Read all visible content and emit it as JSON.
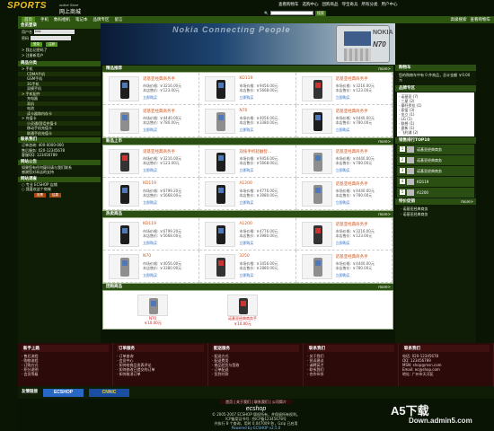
{
  "header": {
    "logo_main": "SPORTS",
    "logo_sub": "online Store",
    "logo_cn": "网上商城",
    "top_links": [
      "查看购物车",
      "选购中心",
      "团购商品",
      "夺宝奇兵",
      "所有分类",
      "用户中心"
    ],
    "search_label": "搜索",
    "search_button": "搜索"
  },
  "nav": {
    "items": [
      "首页",
      "手机",
      "数码相机",
      "笔记本",
      "品牌专区",
      "留言"
    ],
    "active_index": 0,
    "right_items": [
      "高级搜索",
      "查看购物车"
    ]
  },
  "sidebar": {
    "member_title": "会员登录",
    "user_label": "用户名",
    "user_value": "test",
    "pass_label": "密码",
    "login_btn": "登录",
    "reg_btn": "注册",
    "links": [
      "> 我忘记密码了",
      "> 注册新用户"
    ],
    "cat_title": "商品分类",
    "categories": [
      {
        "label": "手机",
        "level": 0
      },
      {
        "label": "CDMA手机",
        "level": 1
      },
      {
        "label": "GSM手机",
        "level": 1
      },
      {
        "label": "3G手机",
        "level": 1
      },
      {
        "label": "双模手机",
        "level": 1
      },
      {
        "label": "手机配件",
        "level": 0
      },
      {
        "label": "充电器",
        "level": 1
      },
      {
        "label": "耳机",
        "level": 1
      },
      {
        "label": "电池",
        "level": 1
      },
      {
        "label": "读卡器和内存卡",
        "level": 1
      },
      {
        "label": "充值卡",
        "level": 0
      },
      {
        "label": "小灵通/固话充值卡",
        "level": 1
      },
      {
        "label": "移动手机充值卡",
        "level": 1
      },
      {
        "label": "联通手机充值卡",
        "level": 1
      }
    ],
    "contact_title": "联系我们",
    "contact_lines": [
      "订单咨询: 400-0000-000",
      "售后服务: 020-12345678",
      "客服QQ: 123456789"
    ],
    "notice_title": "网站公告",
    "notices": [
      "如果您有任何疑问请与我们联系",
      "感谢您对本店的支持"
    ],
    "vote_title": "网站调查",
    "vote_options": [
      "专业 ECSHOP 店铺",
      "我喜欢这个商城"
    ],
    "vote_buttons": [
      "投票",
      "结果"
    ]
  },
  "banner": {
    "text": "Nokia Connecting People",
    "brand": "NOKIA",
    "model": "N70"
  },
  "sections": [
    {
      "title": "精品推荐",
      "more": "more>",
      "items": [
        {
          "name": "诺基亚经典商务手",
          "market": "市场价格: ￥3216.00元",
          "price": "本店售价: ￥123.00元",
          "buy": "立即购买",
          "phone": "dark"
        },
        {
          "name": "KD119",
          "market": "市场价格: ￥9456.00元",
          "price": "本店售价: ￥5668.00元",
          "buy": "立即购买",
          "phone": "dark"
        },
        {
          "name": "诺基亚经典商务手",
          "market": "市场价格: ￥3216.00元",
          "price": "本店售价: ￥123.00元",
          "buy": "立即购买",
          "phone": "red"
        },
        {
          "name": "诺基亚经典商务手",
          "market": "市场价格: ￥4440.00元",
          "price": "本店售价: ￥780.00元",
          "buy": "立即购买",
          "phone": "silver"
        },
        {
          "name": "N70",
          "market": "市场价格: ￥4056.00元",
          "price": "本店售价: ￥3380.00元",
          "buy": "立即购买",
          "phone": "silver"
        },
        {
          "name": "诺基亚经典商务手",
          "market": "市场价格: ￥4440.00元",
          "price": "本店售价: ￥780.00元",
          "buy": "立即购买",
          "phone": "dark"
        }
      ]
    },
    {
      "title": "新品上市",
      "more": "more>",
      "items": [
        {
          "name": "诺基亚经典商务手",
          "market": "市场价格: ￥3216.00元",
          "price": "本店售价: ￥123.00元",
          "buy": "立即购买",
          "phone": "red"
        },
        {
          "name": "双核手机轻触智...",
          "market": "市场价格: ￥9456.00元",
          "price": "本店售价: ￥5668.00元",
          "buy": "立即购买",
          "phone": "dark"
        },
        {
          "name": "诺基亚经典商务手",
          "market": "市场价格: ￥4440.00元",
          "price": "本店售价: ￥780.00元",
          "buy": "立即购买",
          "phone": "silver"
        },
        {
          "name": "KD119",
          "market": "市场价格: ￥6799.20元",
          "price": "本店售价: ￥5668.00元",
          "buy": "立即购买",
          "phone": "dark"
        },
        {
          "name": "A1200",
          "market": "市场价格: ￥4776.00元",
          "price": "本店售价: ￥3980.00元",
          "buy": "立即购买",
          "phone": "dark"
        },
        {
          "name": "诺基亚经典商务手",
          "market": "市场价格: ￥4440.00元",
          "price": "本店售价: ￥780.00元",
          "buy": "立即购买",
          "phone": "silver"
        }
      ]
    },
    {
      "title": "热卖商品",
      "more": "more>",
      "items": [
        {
          "name": "KD119",
          "market": "市场价格: ￥6799.20元",
          "price": "本店售价: ￥5668.00元",
          "buy": "立即购买",
          "phone": "dark"
        },
        {
          "name": "A1200",
          "market": "市场价格: ￥4776.00元",
          "price": "本店售价: ￥3980.00元",
          "buy": "立即购买",
          "phone": "dark"
        },
        {
          "name": "诺基亚经典商务手",
          "market": "市场价格: ￥3216.00元",
          "price": "本店售价: ￥123.00元",
          "buy": "立即购买",
          "phone": "red"
        },
        {
          "name": "N70",
          "market": "市场价格: ￥4056.00元",
          "price": "本店售价: ￥3380.00元",
          "buy": "立即购买",
          "phone": "silver"
        },
        {
          "name": "3250",
          "market": "市场价格: ￥3456.00元",
          "price": "本店售价: ￥2880.00元",
          "buy": "立即购买",
          "phone": "red"
        },
        {
          "name": "诺基亚经典商务手",
          "market": "市场价格: ￥4440.00元",
          "price": "本店售价: ￥780.00元",
          "buy": "立即购买",
          "phone": "silver"
        }
      ]
    }
  ],
  "group_buy": {
    "title": "团购商品",
    "more": "more>",
    "items": [
      {
        "name": "N70",
        "price": "￥10.00元"
      },
      {
        "name": "诺基亚经典商务手",
        "price": "￥10.00元"
      }
    ]
  },
  "right_panel": {
    "cart_title": "购物车",
    "cart_text": "您的购物车中有 0 件商品，总计金额 ￥0.00元",
    "brand_title": "品牌专区",
    "brands": [
      "诺基亚 (7)",
      "三星 (2)",
      "摩托罗拉 (1)",
      "索爱 (3)",
      "金立 (1)",
      "LG (1)",
      "联想 (1)",
      "夏新 (1)",
      "飞利浦 (2)"
    ],
    "top_title": "销售排行TOP10",
    "top_items": [
      "诺基亚经典商务",
      "诺基亚经典商务",
      "诺基亚经典商务",
      "KD119",
      "A1200"
    ],
    "promo_title": "特价促销",
    "more": "more>",
    "promo_items": [
      "诺基亚经典商务",
      "诺基亚经典商务"
    ]
  },
  "footer": {
    "columns": [
      {
        "title": "新手上路",
        "lines": [
          "· 售后流程",
          "· 购物流程",
          "· 订购方式",
          "· 积分说明",
          "· 会员等级"
        ]
      },
      {
        "title": "订单服务",
        "lines": [
          "· 订单查询",
          "· 会员中心",
          "· 如何给商品发表评论",
          "· 如何修改已提交的订单",
          "· 如何取消订单"
        ]
      },
      {
        "title": "配送服务",
        "lines": [
          "· 配送方式",
          "· 配送费用",
          "· 商品验货与签收",
          "· 订单配送",
          "· 货到付款"
        ]
      },
      {
        "title": "联系我们",
        "lines": [
          "· 关于我们",
          "· 投诉建议",
          "· 诚聘英才",
          "· 联系我们",
          "· 合作伙伴"
        ]
      },
      {
        "title": "联系我们",
        "lines": [
          "电话: 020-12345678",
          "QQ: 123456789",
          "MSN: shop@msn.com",
          "Email: ec@shop.com",
          "地址: 广州市天河区"
        ]
      }
    ],
    "links_title": "友情链接",
    "badges": [
      "ECSHOP",
      "CNNIC"
    ],
    "nav_links": [
      "首页",
      "关于我们",
      "联系我们",
      "公司简介"
    ],
    "brand": "ecshop",
    "copyright": "© 2005-2007 ECSHOP 版权所有，并保留所有权利。",
    "icp": "ICP备案证书号: 京ICP备12345678号",
    "stats": "共执行 8 个查询，用时 0.047009 秒，Gzip 已启用",
    "powered": "Powered by ECSHOP v2.5.0"
  },
  "watermark": {
    "main": "A5下载",
    "url": "Down.admin5.com"
  }
}
